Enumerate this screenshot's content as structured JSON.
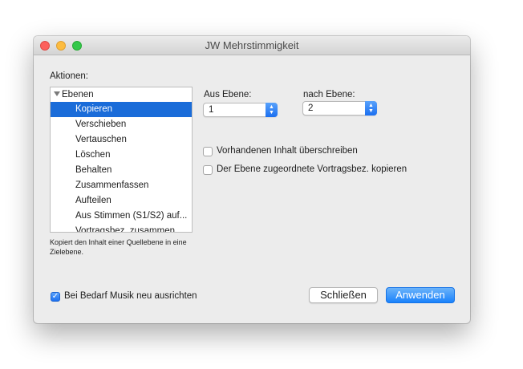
{
  "window": {
    "title": "JW Mehrstimmigkeit"
  },
  "actions": {
    "label": "Aktionen:",
    "group": "Ebenen",
    "items": [
      {
        "label": "Kopieren",
        "selected": true
      },
      {
        "label": "Verschieben"
      },
      {
        "label": "Vertauschen"
      },
      {
        "label": "Löschen"
      },
      {
        "label": "Behalten"
      },
      {
        "label": "Zusammenfassen"
      },
      {
        "label": "Aufteilen"
      },
      {
        "label": "Aus Stimmen (S1/S2) auf..."
      },
      {
        "label": "Vortragsbez. zusammen"
      }
    ],
    "description": "Kopiert den Inhalt einer Quellebene in eine Zielebene."
  },
  "from_layer": {
    "label": "Aus Ebene:",
    "value": "1"
  },
  "to_layer": {
    "label": "nach Ebene:",
    "value": "2"
  },
  "options": {
    "overwrite_label": "Vorhandenen Inhalt überschreiben",
    "overwrite_checked": false,
    "copy_expressions_label": "Der Ebene zugeordnete Vortragsbez. kopieren",
    "copy_expressions_checked": false
  },
  "footer": {
    "realign_label": "Bei Bedarf Musik neu ausrichten",
    "realign_checked": true,
    "close_button": "Schließen",
    "apply_button": "Anwenden"
  },
  "colors": {
    "accent": "#1a6cd9",
    "apply_button": "#1a82fb",
    "close_light": "#fc605c",
    "minimize_light": "#fdbc40",
    "maximize_light": "#34c84a"
  },
  "icons": {
    "stepper": "up-down-chevron-icon",
    "checkmark": "checkmark-icon",
    "disclosure": "disclosure-triangle-icon"
  }
}
